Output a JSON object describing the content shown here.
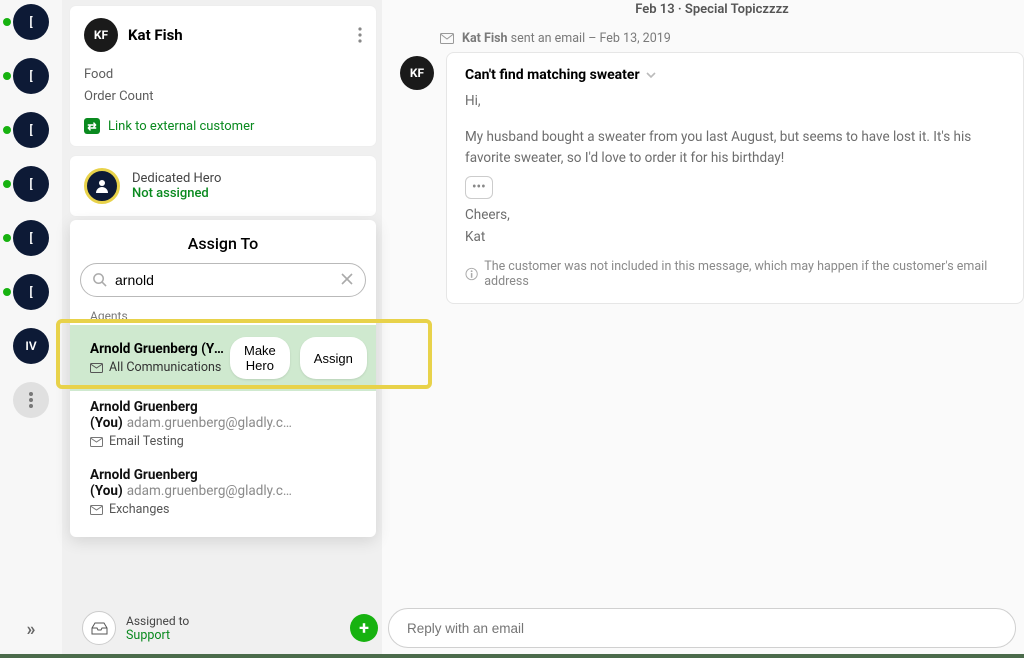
{
  "rail": {
    "items": [
      "[",
      "[",
      "[",
      "[",
      "[",
      "[",
      "IV"
    ],
    "more_icon": "more"
  },
  "customer": {
    "initials": "KF",
    "name": "Kat Fish",
    "meta1": "Food",
    "meta2": "Order Count",
    "link_label": "Link to external customer"
  },
  "hero": {
    "title": "Dedicated Hero",
    "status": "Not assigned"
  },
  "assign": {
    "heading": "Assign To",
    "search_value": "arnold",
    "group_label": "Agents",
    "selected": {
      "name": "Arnold Gruenberg (Yo…",
      "inbox": "All Communications",
      "make_hero": "Make Hero",
      "assign": "Assign"
    },
    "options": [
      {
        "name": "Arnold Gruenberg (You)",
        "email": "adam.gruenberg@gladly.c…",
        "inbox": "Email Testing"
      },
      {
        "name": "Arnold Gruenberg (You)",
        "email": "adam.gruenberg@gladly.c…",
        "inbox": "Exchanges"
      }
    ]
  },
  "thread": {
    "date_line": "Feb 13 · Special Topiczzzz",
    "email_meta_prefix": "Kat Fish",
    "email_meta_suffix": " sent an email – Feb 13, 2019",
    "subject": "Can't find matching sweater",
    "body_hi": "Hi,",
    "body_p1": "My husband bought a sweater from you last August, but seems to have lost it. It's his favorite sweater, so I'd love to order it for his birthday!",
    "body_cheers": "Cheers,",
    "body_sign": "Kat",
    "info_note": "The customer was not included in this message, which may happen if the customer's email address "
  },
  "composer": {
    "assigned_label": "Assigned to",
    "assigned_value": "Support",
    "reply_placeholder": "Reply with an email"
  }
}
